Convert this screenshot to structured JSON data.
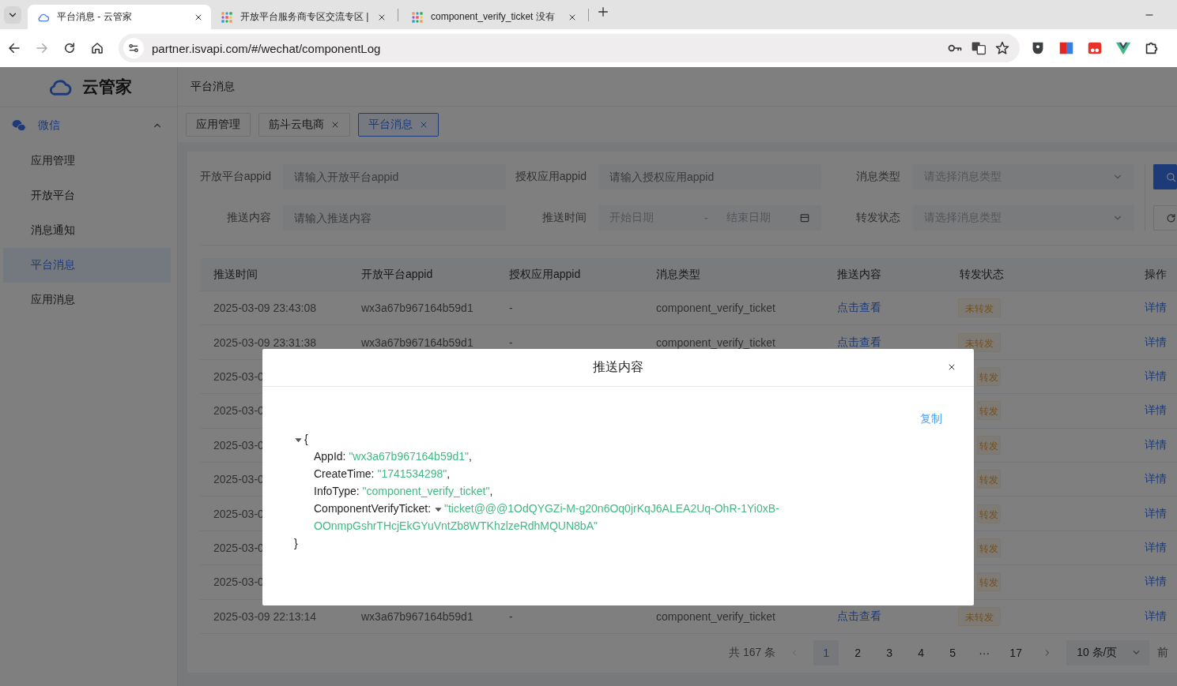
{
  "browser": {
    "tabs": [
      {
        "title": "平台消息 - 云管家",
        "selected": true
      },
      {
        "title": "开放平台服务商专区交流专区 |",
        "selected": false
      },
      {
        "title": "component_verify_ticket 没有",
        "selected": false
      }
    ],
    "url": "partner.isvapi.com/#/wechat/componentLog"
  },
  "sidebar": {
    "logo": "云管家",
    "group": {
      "label": "微信",
      "expanded": true
    },
    "items": [
      {
        "label": "应用管理",
        "selected": false
      },
      {
        "label": "开放平台",
        "selected": false
      },
      {
        "label": "消息通知",
        "selected": false
      },
      {
        "label": "平台消息",
        "selected": true
      },
      {
        "label": "应用消息",
        "selected": false
      }
    ]
  },
  "header": {
    "title": "平台消息"
  },
  "tags": [
    {
      "label": "应用管理",
      "selected": false,
      "closable": false
    },
    {
      "label": "筋斗云电商",
      "selected": false,
      "closable": true
    },
    {
      "label": "平台消息",
      "selected": true,
      "closable": true
    }
  ],
  "filters": [
    {
      "label": "开放平台appid",
      "kind": "text",
      "placeholder": "请输入开放平台appid"
    },
    {
      "label": "授权应用appid",
      "kind": "text",
      "placeholder": "请输入授权应用appid"
    },
    {
      "label": "消息类型",
      "kind": "select",
      "placeholder": "请选择消息类型"
    },
    {
      "label": "推送内容",
      "kind": "text",
      "placeholder": "请输入推送内容"
    },
    {
      "label": "推送时间",
      "kind": "daterange",
      "start_placeholder": "开始日期",
      "separator": "-",
      "end_placeholder": "结束日期"
    },
    {
      "label": "转发状态",
      "kind": "select",
      "placeholder": "请选择消息类型"
    }
  ],
  "filter_buttons": [
    {
      "kind": "search"
    },
    {
      "kind": "reset"
    }
  ],
  "table": {
    "columns": [
      "推送时间",
      "开放平台appid",
      "授权应用appid",
      "消息类型",
      "推送内容",
      "转发状态",
      "操作"
    ],
    "rows": [
      {
        "kind": "full",
        "time": "2025-03-09 23:43:08",
        "appid": "wx3a67b967164b59d1",
        "auth_appid": "-",
        "type": "component_verify_ticket",
        "content": "点击查看",
        "status": "未转发",
        "action": "详情"
      },
      {
        "kind": "full",
        "time": "2025-03-09 23:31:38",
        "appid": "wx3a67b967164b59d1",
        "auth_appid": "-",
        "type": "component_verify_ticket",
        "content": "点击查看",
        "status": "未转发",
        "action": "详情"
      },
      {
        "kind": "cut",
        "time": "2025-03-0",
        "status": "转发",
        "action": "详情"
      },
      {
        "kind": "cut",
        "time": "2025-03-0",
        "status": "转发",
        "action": "详情"
      },
      {
        "kind": "cut",
        "time": "2025-03-0",
        "status": "转发",
        "action": "详情"
      },
      {
        "kind": "cut",
        "time": "2025-03-0",
        "status": "转发",
        "action": "详情"
      },
      {
        "kind": "cut",
        "time": "2025-03-0",
        "status": "转发",
        "action": "详情"
      },
      {
        "kind": "cut",
        "time": "2025-03-0",
        "status": "转发",
        "action": "详情"
      },
      {
        "kind": "cut",
        "time": "2025-03-0",
        "status": "转发",
        "action": "详情"
      },
      {
        "kind": "full",
        "time": "2025-03-09 22:13:14",
        "appid": "wx3a67b967164b59d1",
        "auth_appid": "-",
        "type": "component_verify_ticket",
        "content": "点击查看",
        "status": "未转发",
        "action": "详情"
      }
    ]
  },
  "pagination": {
    "total": "共 167 条",
    "pages": [
      {
        "label": "1",
        "selected": true
      },
      {
        "label": "2",
        "selected": false
      },
      {
        "label": "3",
        "selected": false
      },
      {
        "label": "4",
        "selected": false
      },
      {
        "label": "5",
        "selected": false
      },
      {
        "label": "···",
        "selected": false
      },
      {
        "label": "17",
        "selected": false
      }
    ],
    "page_size": "10 条/页",
    "goto": "前"
  },
  "modal": {
    "title": "推送内容",
    "copy": "复制",
    "json": {
      "expanded": true,
      "open": "{",
      "close": "}",
      "fields": [
        {
          "key": "AppId:",
          "value": "\"wx3a67b967164b59d1\"",
          "sep": ","
        },
        {
          "key": "CreateTime:",
          "value": "\"1741534298\"",
          "sep": ","
        },
        {
          "key": "InfoType:",
          "value": "\"component_verify_ticket\"",
          "sep": ","
        },
        {
          "key": "ComponentVerifyTicket:",
          "expanded": true,
          "value": "\"ticket@@@1OdQYGZi-M-g20n6Oq0jrKqJ6ALEA2Uq-OhR-1Yi0xB-",
          "value_cont": "OOnmpGshrTHcjEkGYuVntZb8WTKhzlzeRdhMQUN8bA\""
        }
      ]
    }
  }
}
